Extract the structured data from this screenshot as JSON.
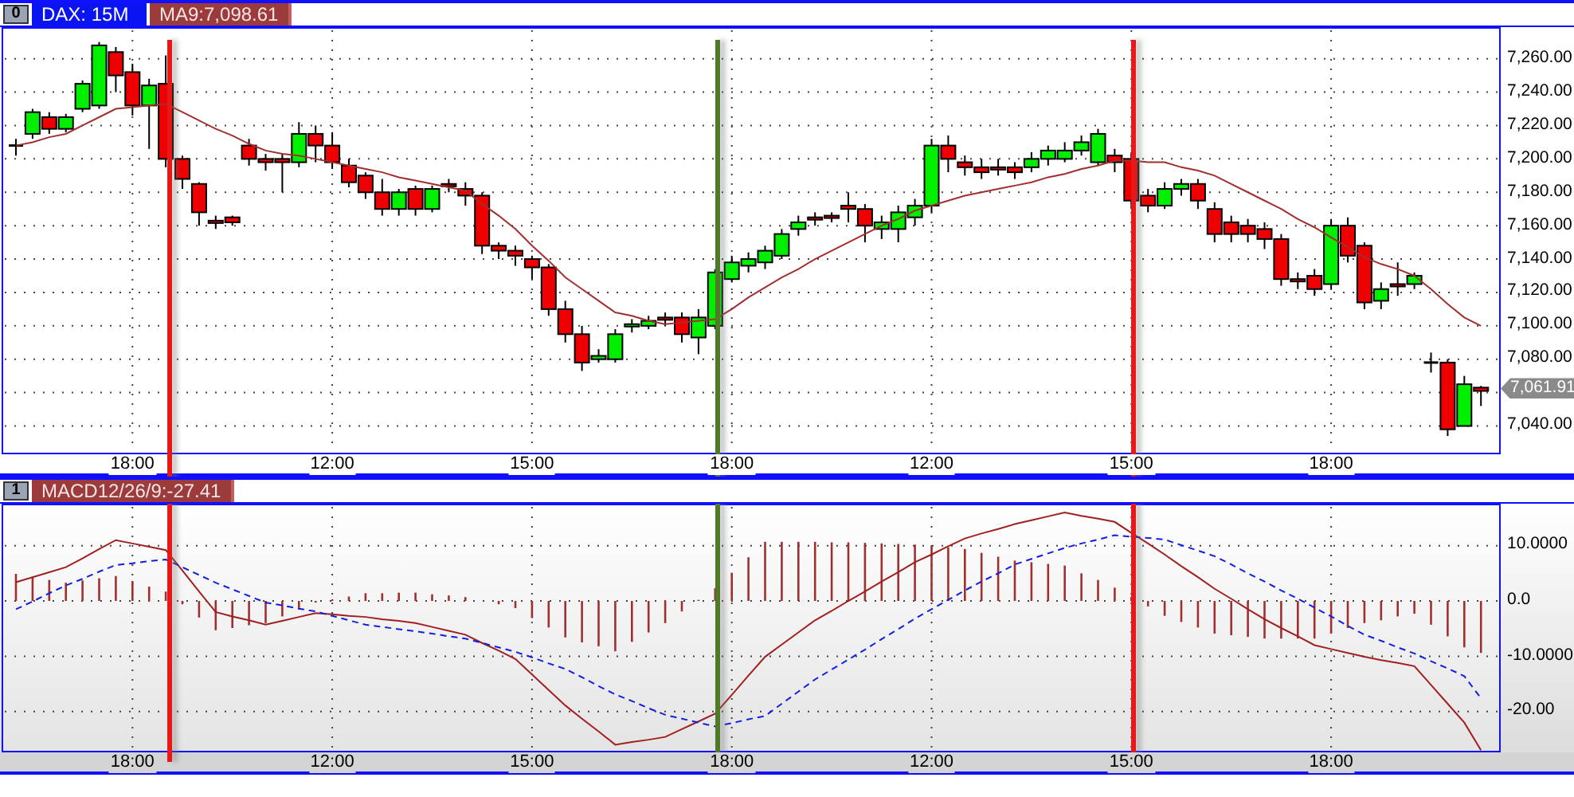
{
  "header": {
    "index_button": "0",
    "symbol": "DAX: 15M",
    "indicator": "MA9:7,098.61"
  },
  "price_panel": {
    "last_price": "7,061.91",
    "chart_data": {
      "type": "candlestick",
      "grid": true,
      "ylim": [
        7024,
        7278
      ],
      "yticks": [
        {
          "value": 7260,
          "label": "7,260.00"
        },
        {
          "value": 7240,
          "label": "7,240.00"
        },
        {
          "value": 7220,
          "label": "7,220.00"
        },
        {
          "value": 7200,
          "label": "7,200.00"
        },
        {
          "value": 7180,
          "label": "7,180.00"
        },
        {
          "value": 7160,
          "label": "7,160.00"
        },
        {
          "value": 7140,
          "label": "7,140.00"
        },
        {
          "value": 7120,
          "label": "7,120.00"
        },
        {
          "value": 7100,
          "label": "7,100.00"
        },
        {
          "value": 7080,
          "label": "7,080.00"
        },
        {
          "value": 7040,
          "label": "7,040.00"
        }
      ],
      "categories": [
        null,
        null,
        null,
        null,
        null,
        null,
        null,
        "18:00",
        null,
        null,
        null,
        null,
        null,
        null,
        null,
        null,
        null,
        null,
        null,
        "12:00",
        null,
        null,
        null,
        null,
        null,
        null,
        null,
        null,
        null,
        null,
        null,
        "15:00",
        null,
        null,
        null,
        null,
        null,
        null,
        null,
        null,
        null,
        null,
        null,
        "18:00",
        null,
        null,
        null,
        null,
        null,
        null,
        null,
        null,
        null,
        null,
        null,
        "12:00",
        null,
        null,
        null,
        null,
        null,
        null,
        null,
        null,
        null,
        null,
        null,
        "15:00",
        null,
        null,
        null,
        null,
        null,
        null,
        null,
        null,
        null,
        null,
        null,
        "18:00",
        null,
        null,
        null,
        null,
        null,
        null,
        null,
        null,
        null
      ],
      "ohlc": [
        [
          7208,
          7212,
          7202,
          7208
        ],
        [
          7215,
          7230,
          7212,
          7228
        ],
        [
          7225,
          7228,
          7215,
          7218
        ],
        [
          7218,
          7227,
          7216,
          7225
        ],
        [
          7230,
          7247,
          7228,
          7245
        ],
        [
          7232,
          7270,
          7230,
          7268
        ],
        [
          7264,
          7267,
          7240,
          7250
        ],
        [
          7252,
          7257,
          7226,
          7232
        ],
        [
          7232,
          7248,
          7206,
          7244
        ],
        [
          7245,
          7262,
          7195,
          7200
        ],
        [
          7200,
          7202,
          7182,
          7188
        ],
        [
          7185,
          7186,
          7160,
          7168
        ],
        [
          7163,
          7166,
          7158,
          7162
        ],
        [
          7165,
          7166,
          7160,
          7162
        ],
        [
          7208,
          7212,
          7196,
          7200
        ],
        [
          7200,
          7203,
          7193,
          7198
        ],
        [
          7200,
          7203,
          7180,
          7198
        ],
        [
          7198,
          7222,
          7195,
          7215
        ],
        [
          7215,
          7220,
          7198,
          7208
        ],
        [
          7208,
          7216,
          7194,
          7198
        ],
        [
          7196,
          7200,
          7183,
          7186
        ],
        [
          7190,
          7192,
          7176,
          7180
        ],
        [
          7180,
          7188,
          7166,
          7170
        ],
        [
          7170,
          7182,
          7166,
          7180
        ],
        [
          7182,
          7184,
          7166,
          7170
        ],
        [
          7170,
          7184,
          7168,
          7182
        ],
        [
          7185,
          7188,
          7180,
          7184
        ],
        [
          7182,
          7186,
          7172,
          7178
        ],
        [
          7178,
          7180,
          7143,
          7148
        ],
        [
          7148,
          7150,
          7140,
          7145
        ],
        [
          7145,
          7148,
          7136,
          7142
        ],
        [
          7140,
          7142,
          7128,
          7135
        ],
        [
          7135,
          7137,
          7106,
          7110
        ],
        [
          7110,
          7115,
          7090,
          7095
        ],
        [
          7095,
          7100,
          7073,
          7078
        ],
        [
          7080,
          7086,
          7078,
          7082
        ],
        [
          7080,
          7098,
          7078,
          7095
        ],
        [
          7100,
          7104,
          7096,
          7101
        ],
        [
          7100,
          7106,
          7098,
          7103
        ],
        [
          7105,
          7108,
          7100,
          7104
        ],
        [
          7105,
          7108,
          7090,
          7095
        ],
        [
          7093,
          7110,
          7083,
          7105
        ],
        [
          7100,
          7134,
          7098,
          7132
        ],
        [
          7128,
          7142,
          7126,
          7138
        ],
        [
          7136,
          7144,
          7132,
          7140
        ],
        [
          7138,
          7148,
          7134,
          7145
        ],
        [
          7142,
          7158,
          7140,
          7155
        ],
        [
          7158,
          7166,
          7154,
          7162
        ],
        [
          7165,
          7168,
          7160,
          7164
        ],
        [
          7166,
          7168,
          7162,
          7165
        ],
        [
          7172,
          7180,
          7162,
          7170
        ],
        [
          7170,
          7173,
          7150,
          7160
        ],
        [
          7158,
          7166,
          7152,
          7162
        ],
        [
          7158,
          7172,
          7150,
          7168
        ],
        [
          7165,
          7176,
          7160,
          7172
        ],
        [
          7172,
          7212,
          7168,
          7208
        ],
        [
          7208,
          7214,
          7192,
          7200
        ],
        [
          7198,
          7202,
          7190,
          7195
        ],
        [
          7195,
          7200,
          7188,
          7192
        ],
        [
          7195,
          7200,
          7190,
          7194
        ],
        [
          7195,
          7198,
          7188,
          7192
        ],
        [
          7195,
          7204,
          7192,
          7200
        ],
        [
          7200,
          7208,
          7196,
          7205
        ],
        [
          7200,
          7210,
          7198,
          7205
        ],
        [
          7205,
          7214,
          7202,
          7210
        ],
        [
          7198,
          7218,
          7196,
          7215
        ],
        [
          7202,
          7206,
          7192,
          7198
        ],
        [
          7200,
          7204,
          7170,
          7175
        ],
        [
          7178,
          7182,
          7168,
          7172
        ],
        [
          7172,
          7186,
          7170,
          7182
        ],
        [
          7182,
          7188,
          7178,
          7185
        ],
        [
          7185,
          7188,
          7170,
          7175
        ],
        [
          7170,
          7174,
          7150,
          7155
        ],
        [
          7162,
          7166,
          7150,
          7155
        ],
        [
          7160,
          7164,
          7150,
          7155
        ],
        [
          7158,
          7162,
          7146,
          7152
        ],
        [
          7152,
          7155,
          7124,
          7128
        ],
        [
          7128,
          7132,
          7122,
          7127
        ],
        [
          7130,
          7134,
          7118,
          7122
        ],
        [
          7125,
          7164,
          7122,
          7160
        ],
        [
          7160,
          7165,
          7138,
          7142
        ],
        [
          7148,
          7150,
          7110,
          7114
        ],
        [
          7115,
          7126,
          7110,
          7122
        ],
        [
          7125,
          7138,
          7118,
          7124
        ],
        [
          7125,
          7132,
          7122,
          7130
        ],
        [
          7078,
          7084,
          7072,
          7078
        ],
        [
          7078,
          7080,
          7034,
          7038
        ],
        [
          7040,
          7070,
          7040,
          7065
        ],
        [
          7063,
          7064,
          7052,
          7061
        ]
      ],
      "series": [
        {
          "type": "line",
          "color": "#a03030",
          "values": [
            7208,
            7210,
            7213,
            7215,
            7220,
            7225,
            7230,
            7231,
            7232,
            7233,
            7228,
            7223,
            7218,
            7214,
            7209,
            7205,
            7203,
            7202,
            7200,
            7198,
            7196,
            7194,
            7192,
            7189,
            7187,
            7185,
            7183,
            7181,
            7173,
            7166,
            7158,
            7148,
            7139,
            7129,
            7122,
            7115,
            7108,
            7106,
            7103,
            7101,
            7102,
            7103,
            7104,
            7110,
            7117,
            7123,
            7129,
            7134,
            7140,
            7145,
            7150,
            7155,
            7160,
            7164,
            7169,
            7172,
            7175,
            7178,
            7180,
            7182,
            7184,
            7186,
            7189,
            7191,
            7194,
            7196,
            7199,
            7199,
            7198,
            7198,
            7195,
            7193,
            7190,
            7185,
            7180,
            7175,
            7170,
            7164,
            7159,
            7153,
            7147,
            7141,
            7137,
            7134,
            7130,
            7122,
            7113,
            7105,
            7100
          ]
        }
      ]
    }
  },
  "macd_panel": {
    "index_button": "1",
    "indicator": "MACD12/26/9:-27.41",
    "chart_data": {
      "type": "line",
      "grid": true,
      "ylim": [
        -27.1,
        17.3
      ],
      "yticks": [
        {
          "value": 10,
          "label": "10.0000"
        },
        {
          "value": 0,
          "label": "0.0"
        },
        {
          "value": -10,
          "label": "-10.0000"
        },
        {
          "value": -20,
          "label": "-20.00"
        }
      ],
      "categories": [
        null,
        null,
        null,
        null,
        null,
        null,
        null,
        "18:00",
        null,
        null,
        null,
        null,
        null,
        null,
        null,
        null,
        null,
        null,
        null,
        "12:00",
        null,
        null,
        null,
        null,
        null,
        null,
        null,
        null,
        null,
        null,
        null,
        "15:00",
        null,
        null,
        null,
        null,
        null,
        null,
        null,
        null,
        null,
        null,
        null,
        "18:00",
        null,
        null,
        null,
        null,
        null,
        null,
        null,
        null,
        null,
        null,
        null,
        "12:00",
        null,
        null,
        null,
        null,
        null,
        null,
        null,
        null,
        null,
        null,
        null,
        "15:00",
        null,
        null,
        null,
        null,
        null,
        null,
        null,
        null,
        null,
        null,
        null,
        "18:00",
        null,
        null,
        null,
        null,
        null,
        null,
        null,
        null,
        null
      ],
      "series": [
        {
          "color": "#a02020",
          "values": [
            3.4,
            4.3,
            5.2,
            6.1,
            7.7,
            9.4,
            11,
            10.4,
            9.8,
            9.2,
            5.5,
            1.7,
            -2,
            -2.8,
            -3.5,
            -4.3,
            -3.6,
            -2.9,
            -2.2,
            -2.4,
            -2.7,
            -2.9,
            -3.3,
            -3.6,
            -4,
            -4.7,
            -5.4,
            -6.1,
            -7.6,
            -9,
            -10.5,
            -13.3,
            -16.1,
            -18.9,
            -21.3,
            -23.6,
            -26,
            -25.5,
            -25.1,
            -24.6,
            -23.2,
            -21.8,
            -20.4,
            -17,
            -13.5,
            -10.1,
            -7.9,
            -5.7,
            -3.5,
            -1.8,
            0,
            1.7,
            3.5,
            5.2,
            7,
            8.4,
            9.9,
            11.3,
            12.2,
            13,
            13.9,
            14.6,
            15.3,
            16,
            15.4,
            14.9,
            14.3,
            12.3,
            10.4,
            8.4,
            6.3,
            4.3,
            2.2,
            0.4,
            -1.5,
            -3.3,
            -4.9,
            -6.4,
            -8,
            -8.7,
            -9.4,
            -10.1,
            -10.7,
            -11.2,
            -11.8,
            -15.2,
            -18.6,
            -22,
            -27
          ]
        },
        {
          "color": "#1020e0",
          "line_style": "dashed",
          "values": [
            -1.5,
            -0.1,
            1.4,
            2.8,
            4,
            5.3,
            6.5,
            6.8,
            7.2,
            7.5,
            6.1,
            4.7,
            3.3,
            2.1,
            0.9,
            -0.3,
            -0.8,
            -1.4,
            -1.9,
            -2.7,
            -3.5,
            -4.3,
            -4.7,
            -5.1,
            -5.5,
            -5.9,
            -6.4,
            -6.8,
            -7.6,
            -8.4,
            -9.2,
            -10.2,
            -11.3,
            -12.3,
            -13.8,
            -15.4,
            -16.9,
            -18.1,
            -19.4,
            -20.6,
            -21.3,
            -22,
            -22.7,
            -22.1,
            -21.4,
            -20.8,
            -18.6,
            -16.4,
            -14.2,
            -12.4,
            -10.6,
            -8.8,
            -6.9,
            -5.1,
            -3.2,
            -1.5,
            0.2,
            1.9,
            3.5,
            5,
            6.6,
            7.6,
            8.6,
            9.6,
            10.4,
            11.1,
            11.9,
            11.6,
            11.4,
            11.1,
            10.1,
            9.1,
            8.1,
            6.6,
            5,
            3.5,
            1.9,
            0.4,
            -1.2,
            -2.8,
            -4.5,
            -6.1,
            -7.2,
            -8.4,
            -9.5,
            -10.9,
            -12.2,
            -13.6,
            -17.6
          ]
        }
      ]
    }
  },
  "markers": [
    {
      "color": "#e81818"
    },
    {
      "color": "#4f7a28"
    },
    {
      "color": "#e81818"
    }
  ]
}
